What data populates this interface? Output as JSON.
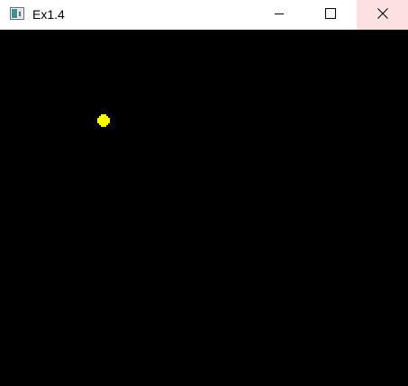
{
  "window": {
    "title": "Ex1.4",
    "icon": "app-window-icon",
    "controls": {
      "minimize_icon": "minimize-icon",
      "maximize_icon": "maximize-icon",
      "close_icon": "close-icon"
    },
    "close_hover_color": "#fde1e1"
  },
  "canvas": {
    "background_color": "#000000",
    "point_color": "#ffff00"
  }
}
